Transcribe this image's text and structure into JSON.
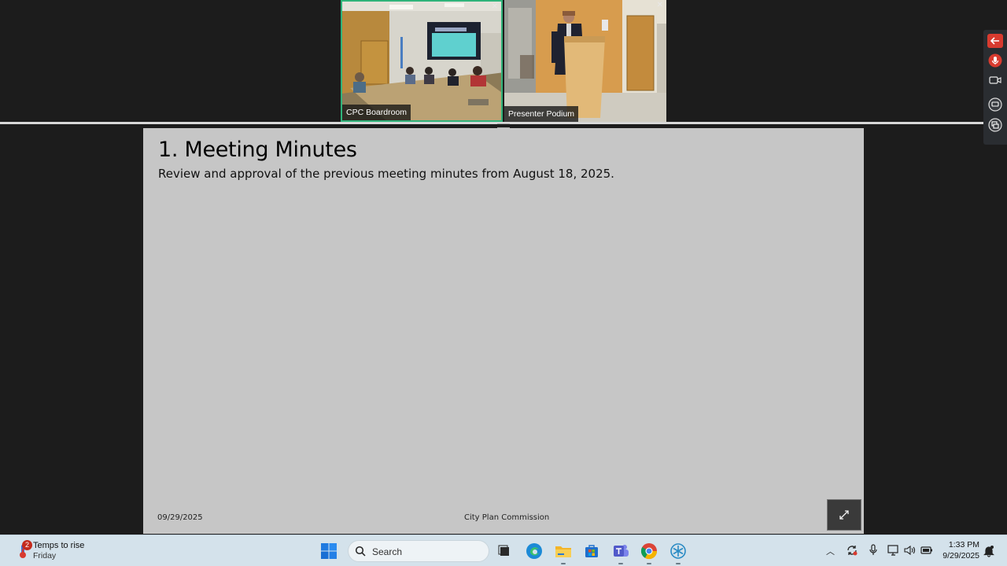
{
  "video_tiles": [
    {
      "label": "CPC Boardroom",
      "active": true
    },
    {
      "label": "Presenter Podium",
      "active": false
    }
  ],
  "side_toolbar": {
    "icons": [
      "back-arrow-icon",
      "microphone-icon",
      "camera-icon",
      "chat-icon",
      "share-screen-icon"
    ],
    "accent": "#d83b2f"
  },
  "slide": {
    "title": "1. Meeting Minutes",
    "body": "Review and approval of the previous meeting minutes from August 18, 2025.",
    "footer_date": "09/29/2025",
    "footer_org": "City Plan Commission",
    "background": "#c6c6c6"
  },
  "taskbar": {
    "weather": {
      "badge": "2",
      "title": "Temps to rise",
      "subtitle": "Friday"
    },
    "search_label": "Search",
    "apps": [
      "start-icon",
      "task-view-icon",
      "edge-icon",
      "file-explorer-icon",
      "store-icon",
      "teams-icon",
      "chrome-icon",
      "snowflake-app-icon"
    ],
    "tray_icons": [
      "chevron-up-icon",
      "sync-icon",
      "microphone-icon",
      "display-icon",
      "volume-icon",
      "battery-icon"
    ],
    "clock": {
      "time": "1:33 PM",
      "date": "9/29/2025"
    }
  }
}
